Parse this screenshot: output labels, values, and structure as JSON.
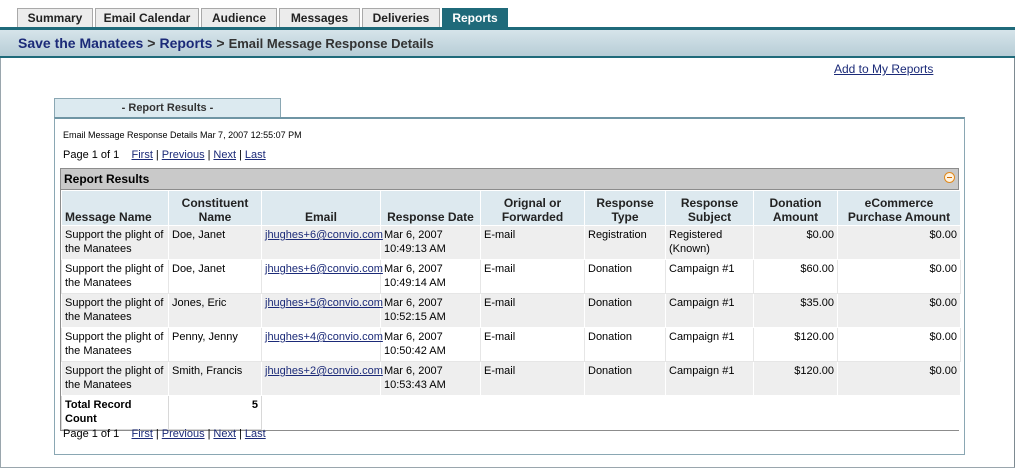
{
  "tabs": [
    {
      "label": "Summary",
      "active": false
    },
    {
      "label": "Email Calendar",
      "active": false
    },
    {
      "label": "Audience",
      "active": false
    },
    {
      "label": "Messages",
      "active": false
    },
    {
      "label": "Deliveries",
      "active": false
    },
    {
      "label": "Reports",
      "active": true
    }
  ],
  "breadcrumb": {
    "root": "Save the Manatees",
    "sep1": ">",
    "section": "Reports",
    "sep2": ">",
    "current": "Email Message Response Details"
  },
  "add_to_reports": "Add to My Reports",
  "report_tab_label": "- Report Results -",
  "report_meta": "Email Message Response Details Mar 7, 2007 12:55:07 PM",
  "pager": {
    "status": "Page 1 of 1",
    "first": "First",
    "previous": "Previous",
    "next": "Next",
    "last": "Last",
    "separator": "|"
  },
  "results": {
    "title": "Report Results",
    "columns": [
      "Message Name",
      "Constituent Name",
      "Email",
      "Response Date",
      "Orignal or Forwarded",
      "Response Type",
      "Response Subject",
      "Donation Amount",
      "eCommerce Purchase Amount"
    ],
    "rows": [
      {
        "message": "Support the plight of the Manatees",
        "constituent": "Doe, Janet",
        "email": "jhughes+6@convio.com",
        "date": "Mar 6, 2007 10:49:13 AM",
        "orig": "E-mail",
        "type": "Registration",
        "subject": "Registered (Known)",
        "donation": "$0.00",
        "ecommerce": "$0.00"
      },
      {
        "message": "Support the plight of the Manatees",
        "constituent": "Doe, Janet",
        "email": "jhughes+6@convio.com",
        "date": "Mar 6, 2007 10:49:14 AM",
        "orig": "E-mail",
        "type": "Donation",
        "subject": "Campaign #1",
        "donation": "$60.00",
        "ecommerce": "$0.00"
      },
      {
        "message": "Support the plight of the Manatees",
        "constituent": "Jones, Eric",
        "email": "jhughes+5@convio.com",
        "date": "Mar 6, 2007 10:52:15 AM",
        "orig": "E-mail",
        "type": "Donation",
        "subject": "Campaign #1",
        "donation": "$35.00",
        "ecommerce": "$0.00"
      },
      {
        "message": "Support the plight of the Manatees",
        "constituent": "Penny, Jenny",
        "email": "jhughes+4@convio.com",
        "date": "Mar 6, 2007 10:50:42 AM",
        "orig": "E-mail",
        "type": "Donation",
        "subject": "Campaign #1",
        "donation": "$120.00",
        "ecommerce": "$0.00"
      },
      {
        "message": "Support the plight of the Manatees",
        "constituent": "Smith, Francis",
        "email": "jhughes+2@convio.com",
        "date": "Mar 6, 2007 10:53:43 AM",
        "orig": "E-mail",
        "type": "Donation",
        "subject": "Campaign #1",
        "donation": "$120.00",
        "ecommerce": "$0.00"
      }
    ],
    "total_label": "Total Record Count",
    "total_value": "5"
  },
  "colors": {
    "accent": "#1f6a7a",
    "link": "#1b2a78",
    "header_bg": "#dde9ef"
  }
}
